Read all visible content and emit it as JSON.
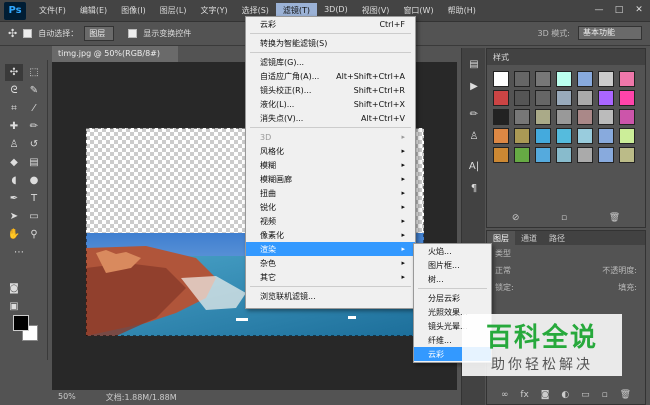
{
  "app": {
    "logo": "Ps"
  },
  "menubar": {
    "items": [
      "文件(F)",
      "编辑(E)",
      "图像(I)",
      "图层(L)",
      "文字(Y)",
      "选择(S)",
      "滤镜(T)",
      "3D(D)",
      "视图(V)",
      "窗口(W)",
      "帮助(H)"
    ],
    "active_index": 6
  },
  "window_controls": {
    "minimize": "—",
    "maximize": "□",
    "close": "✕"
  },
  "options": {
    "auto_select_label": "自动选择：",
    "auto_select_value": "图层",
    "show_transform_label": "显示变换控件",
    "mode3d_label": "3D 模式:",
    "workspace": "基本功能"
  },
  "document": {
    "tab_title": "timg.jpg @ 50%(RGB/8#)",
    "zoom": "50%",
    "doc_info": "文档:1.88M/1.88M"
  },
  "filter_menu": {
    "items": [
      {
        "label": "云彩",
        "shortcut": "Ctrl+F",
        "type": "item"
      },
      {
        "type": "sep"
      },
      {
        "label": "转换为智能滤镜(S)",
        "type": "item"
      },
      {
        "type": "sep"
      },
      {
        "label": "滤镜库(G)...",
        "type": "item"
      },
      {
        "label": "自适应广角(A)...",
        "shortcut": "Alt+Shift+Ctrl+A",
        "type": "item"
      },
      {
        "label": "镜头校正(R)...",
        "shortcut": "Shift+Ctrl+R",
        "type": "item"
      },
      {
        "label": "液化(L)...",
        "shortcut": "Shift+Ctrl+X",
        "type": "item"
      },
      {
        "label": "消失点(V)...",
        "shortcut": "Alt+Ctrl+V",
        "type": "item"
      },
      {
        "type": "sep"
      },
      {
        "label": "3D",
        "type": "sub",
        "disabled": true
      },
      {
        "label": "风格化",
        "type": "sub"
      },
      {
        "label": "模糊",
        "type": "sub"
      },
      {
        "label": "模糊画廊",
        "type": "sub"
      },
      {
        "label": "扭曲",
        "type": "sub"
      },
      {
        "label": "锐化",
        "type": "sub"
      },
      {
        "label": "视频",
        "type": "sub"
      },
      {
        "label": "像素化",
        "type": "sub"
      },
      {
        "label": "渲染",
        "type": "sub",
        "highlight": true
      },
      {
        "label": "杂色",
        "type": "sub"
      },
      {
        "label": "其它",
        "type": "sub"
      },
      {
        "type": "sep"
      },
      {
        "label": "浏览联机滤镜...",
        "type": "item"
      }
    ]
  },
  "render_submenu": {
    "items": [
      {
        "label": "火焰...",
        "type": "item"
      },
      {
        "label": "图片框...",
        "type": "item"
      },
      {
        "label": "树...",
        "type": "item"
      },
      {
        "type": "sep"
      },
      {
        "label": "分层云彩",
        "type": "item"
      },
      {
        "label": "光照效果...",
        "type": "item"
      },
      {
        "label": "镜头光晕...",
        "type": "item"
      },
      {
        "label": "纤维...",
        "type": "item"
      },
      {
        "label": "云彩",
        "type": "item",
        "highlight": true
      }
    ]
  },
  "swatches_panel": {
    "tab": "样式"
  },
  "layers_panel": {
    "tabs": [
      "图层",
      "通道",
      "路径"
    ],
    "kind_label": "类型",
    "blend_mode": "正常",
    "opacity_label": "不透明度:",
    "lock_label": "锁定:",
    "fill_label": "填充:"
  },
  "watermark": {
    "title": "百科全说",
    "subtitle": "助你轻松解决"
  },
  "colors": {
    "menu_highlight": "#3399ff",
    "active_menu": "#9bb2d6",
    "watermark_green": "#27a93c"
  }
}
